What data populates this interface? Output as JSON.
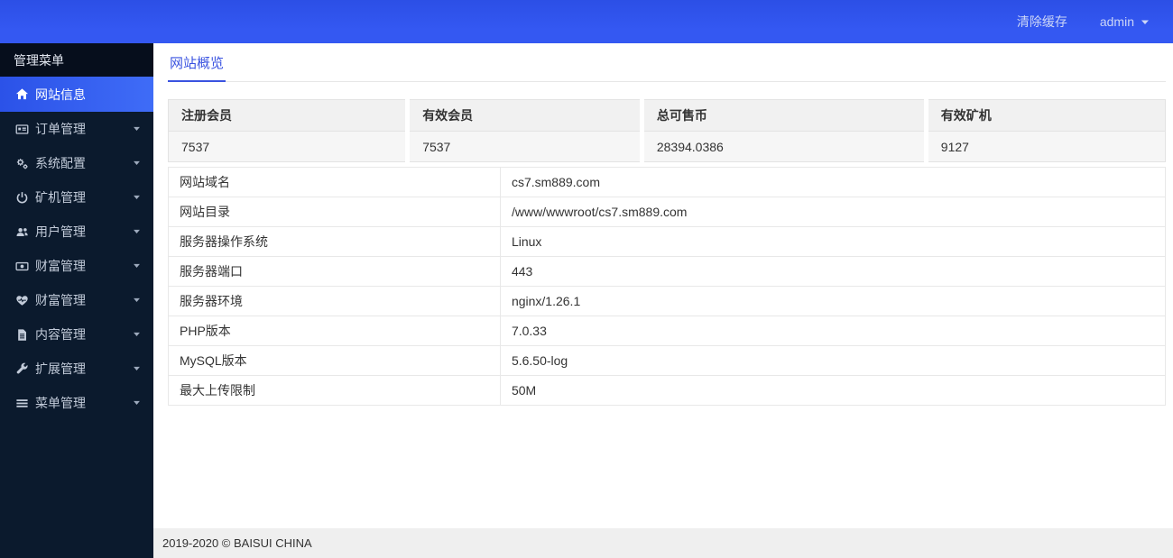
{
  "topbar": {
    "clear_cache": "清除缓存",
    "user": "admin"
  },
  "sidebar": {
    "header": "管理菜单",
    "items": [
      {
        "label": "网站信息",
        "icon": "home-icon",
        "active": true
      },
      {
        "label": "订单管理",
        "icon": "order-card-icon"
      },
      {
        "label": "系统配置",
        "icon": "cogs-icon"
      },
      {
        "label": "矿机管理",
        "icon": "power-icon"
      },
      {
        "label": "用户管理",
        "icon": "users-icon"
      },
      {
        "label": "财富管理",
        "icon": "money-icon"
      },
      {
        "label": "财富管理",
        "icon": "heart-icon"
      },
      {
        "label": "内容管理",
        "icon": "file-icon"
      },
      {
        "label": "扩展管理",
        "icon": "wrench-icon"
      },
      {
        "label": "菜单管理",
        "icon": "bars-icon"
      }
    ]
  },
  "main": {
    "tab": "网站概览",
    "stats": {
      "headers": [
        "注册会员",
        "有效会员",
        "总可售币",
        "有效矿机"
      ],
      "values": [
        "7537",
        "7537",
        "28394.0386",
        "9127"
      ]
    },
    "info_rows": [
      {
        "label": "网站域名",
        "value": "cs7.sm889.com"
      },
      {
        "label": "网站目录",
        "value": "/www/wwwroot/cs7.sm889.com"
      },
      {
        "label": "服务器操作系统",
        "value": "Linux"
      },
      {
        "label": "服务器端口",
        "value": "443"
      },
      {
        "label": "服务器环境",
        "value": "nginx/1.26.1"
      },
      {
        "label": "PHP版本",
        "value": "7.0.33"
      },
      {
        "label": "MySQL版本",
        "value": "5.6.50-log"
      },
      {
        "label": "最大上传限制",
        "value": "50M"
      }
    ]
  },
  "footer": {
    "copyright": "2019-2020 © BAISUI CHINA"
  },
  "colors": {
    "topbar_blue": "#3356f1",
    "sidebar_dark": "#0b1a2d",
    "sidebar_header_dark": "#060e1c",
    "active_item_blue": "#3f6cf7",
    "tab_accent": "#3a53e0",
    "footer_gray": "#efefef"
  }
}
